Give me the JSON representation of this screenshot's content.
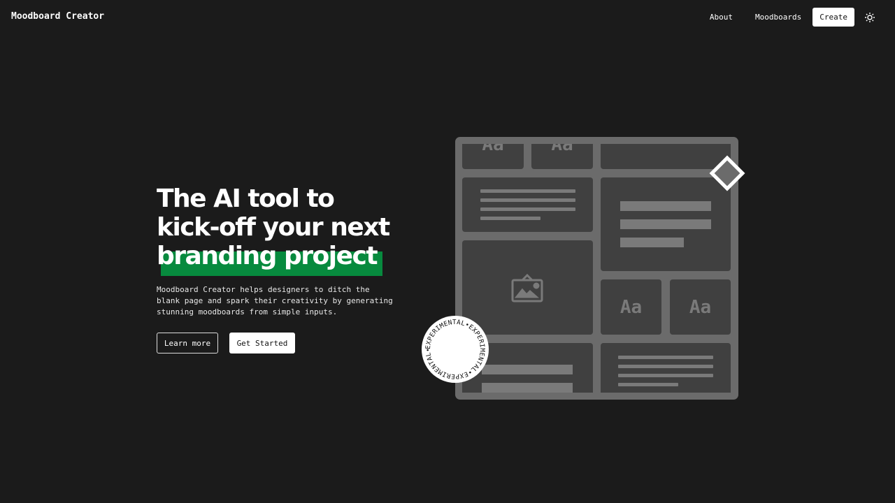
{
  "header": {
    "logo": "Moodboard Creator",
    "nav": [
      {
        "label": "About"
      },
      {
        "label": "Moodboards"
      },
      {
        "label": "Create"
      }
    ],
    "theme_icon": "sun-icon"
  },
  "hero": {
    "title_line1": "The AI tool to",
    "title_line2": "kick-off your next",
    "title_highlight": "branding project",
    "description": "Moodboard Creator helps designers to ditch the blank page and spark their creativity by generating stunning moodboards from simple inputs.",
    "learn_more": "Learn more",
    "get_started": "Get Started"
  },
  "illustration": {
    "font_sample": "Aa",
    "badge_text": "EXPERIMENTAL•EXPERIMENTAL•EXPERIMENTAL•",
    "highlight_color": "#078a3e"
  }
}
